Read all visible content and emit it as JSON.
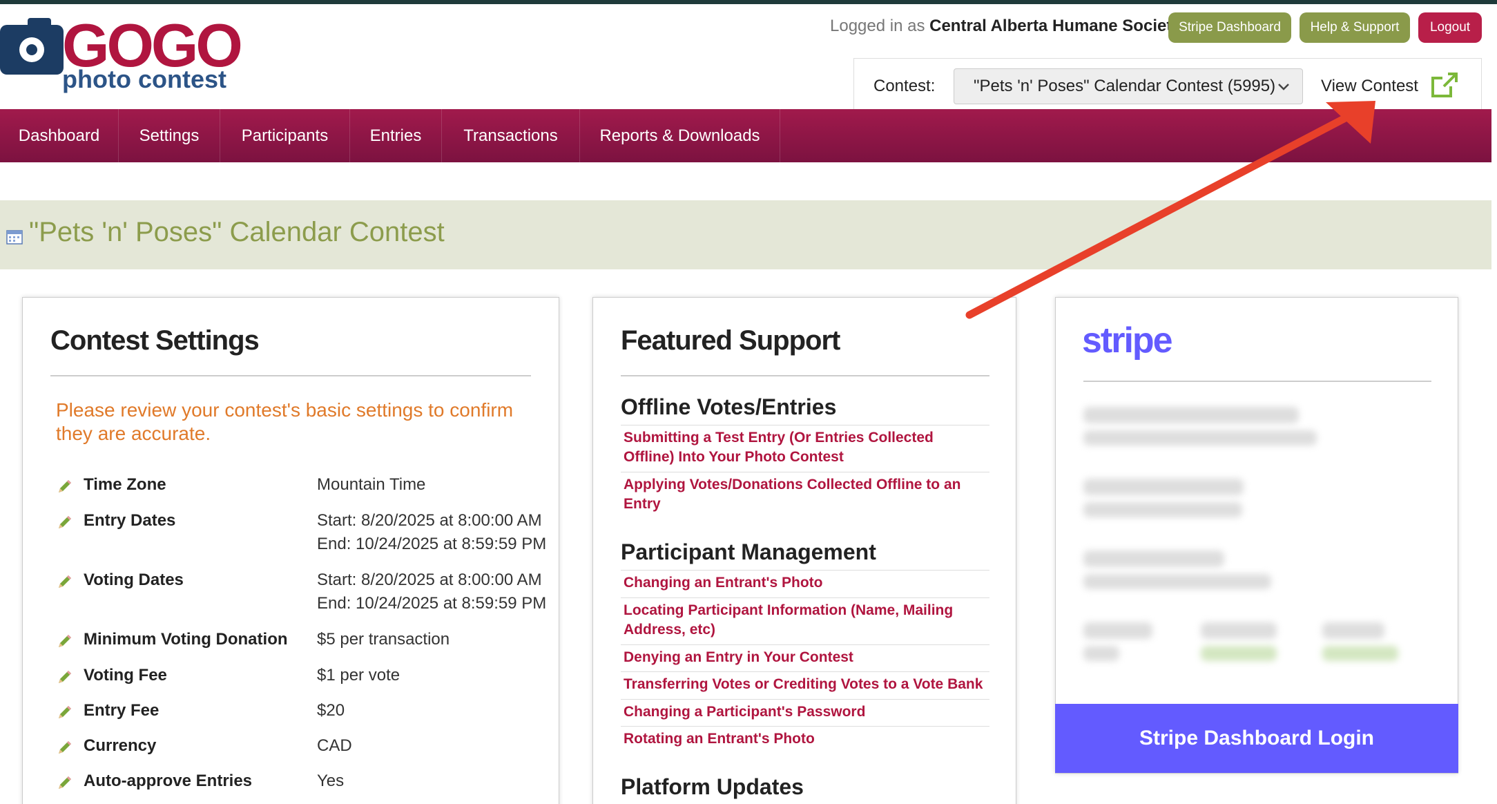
{
  "logo": {
    "brand": "GOGO",
    "sub": "photo contest"
  },
  "header": {
    "logged_prefix": "Logged in as",
    "org_name": "Central Alberta Humane Society",
    "buttons": {
      "stripe": "Stripe Dashboard",
      "help": "Help & Support",
      "logout": "Logout"
    },
    "contest_label": "Contest:",
    "contest_selected": "\"Pets 'n' Poses\" Calendar Contest (5995)",
    "view_contest": "View Contest"
  },
  "nav": [
    "Dashboard",
    "Settings",
    "Participants",
    "Entries",
    "Transactions",
    "Reports & Downloads"
  ],
  "page_title": "\"Pets 'n' Poses\" Calendar Contest",
  "contest_settings": {
    "heading": "Contest Settings",
    "notice": "Please review your contest's basic settings to confirm they are accurate.",
    "rows": [
      {
        "label": "Time Zone",
        "value": "Mountain Time"
      },
      {
        "label": "Entry Dates",
        "value": "Start: 8/20/2025 at 8:00:00 AM",
        "value2": "End: 10/24/2025 at 8:59:59 PM"
      },
      {
        "label": "Voting Dates",
        "value": "Start: 8/20/2025 at 8:00:00 AM",
        "value2": "End: 10/24/2025 at 8:59:59 PM"
      },
      {
        "label": "Minimum Voting Donation",
        "value": "$5 per transaction"
      },
      {
        "label": "Voting Fee",
        "value": "$1 per vote"
      },
      {
        "label": "Entry Fee",
        "value": "$20"
      },
      {
        "label": "Currency",
        "value": "CAD"
      },
      {
        "label": "Auto-approve Entries",
        "value": "Yes"
      }
    ]
  },
  "featured_support": {
    "heading": "Featured Support",
    "sections": [
      {
        "title": "Offline Votes/Entries",
        "links": [
          "Submitting a Test Entry (Or Entries Collected Offline) Into Your Photo Contest",
          "Applying Votes/Donations Collected Offline to an Entry"
        ]
      },
      {
        "title": "Participant Management",
        "links": [
          "Changing an Entrant's Photo",
          "Locating Participant Information (Name, Mailing Address, etc)",
          "Denying an Entry in Your Contest",
          "Transferring Votes or Crediting Votes to a Vote Bank",
          "Changing a Participant's Password",
          "Rotating an Entrant's Photo"
        ]
      },
      {
        "title": "Platform Updates",
        "links": []
      }
    ]
  },
  "stripe": {
    "logo": "stripe",
    "login": "Stripe Dashboard Login"
  },
  "colors": {
    "accent": "#b0153f",
    "nav": "#8f1646",
    "olive": "#8a9a4a",
    "stripe": "#635bff",
    "orange": "#e07a2a",
    "arrow": "#e8402a"
  }
}
